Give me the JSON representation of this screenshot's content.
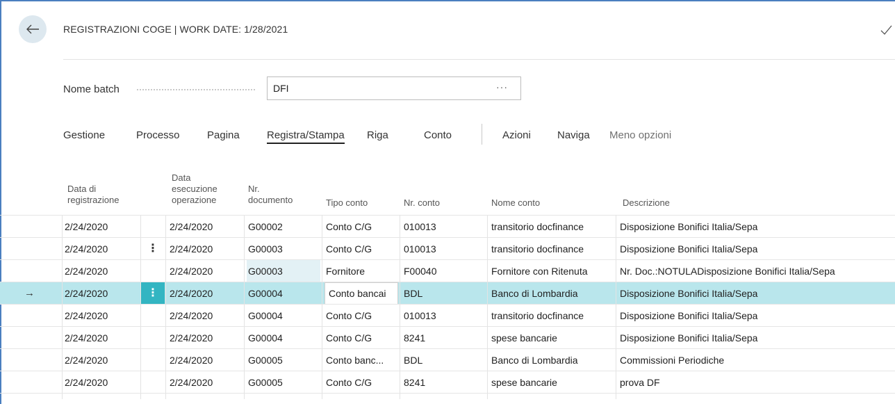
{
  "page": {
    "title": "REGISTRAZIONI COGE | WORK DATE: 1/28/2021"
  },
  "batch": {
    "label": "Nome batch",
    "value": "DFI",
    "lookup": "···"
  },
  "actions": [
    {
      "label": "Gestione"
    },
    {
      "label": "Processo"
    },
    {
      "label": "Pagina"
    },
    {
      "label": "Registra/Stampa"
    },
    {
      "label": "Riga"
    },
    {
      "label": "Conto"
    },
    {
      "label": "Azioni"
    },
    {
      "label": "Naviga"
    },
    {
      "label": "Meno opzioni"
    }
  ],
  "columns": {
    "data_reg": [
      "Data di",
      "registrazione"
    ],
    "data_exec": [
      "Data",
      "esecuzione",
      "operazione"
    ],
    "nr_doc": [
      "Nr.",
      "documento"
    ],
    "tipo_conto": "Tipo conto",
    "nr_conto": "Nr. conto",
    "nome_conto": "Nome conto",
    "descrizione": "Descrizione"
  },
  "rows": [
    {
      "data_reg": "2/24/2020",
      "menu": "",
      "data_exec": "2/24/2020",
      "nr_doc": "G00002",
      "tipo_conto": "Conto C/G",
      "nr_conto": "010013",
      "nome_conto": "transitorio docfinance",
      "descrizione": "Disposizione Bonifici Italia/Sepa"
    },
    {
      "data_reg": "2/24/2020",
      "menu": "⋮",
      "data_exec": "2/24/2020",
      "nr_doc": "G00003",
      "tipo_conto": "Conto C/G",
      "nr_conto": "010013",
      "nome_conto": "transitorio docfinance",
      "descrizione": "Disposizione Bonifici Italia/Sepa"
    },
    {
      "data_reg": "2/24/2020",
      "menu": "",
      "data_exec": "2/24/2020",
      "nr_doc": "G00003",
      "tipo_conto": "Fornitore",
      "nr_conto": "F00040",
      "nome_conto": "Fornitore con Ritenuta",
      "descrizione": "Nr. Doc.:NOTULADisposizione Bonifici Italia/Sepa"
    },
    {
      "marker": "→",
      "data_reg": "2/24/2020",
      "menu": "⋮",
      "data_exec": "2/24/2020",
      "nr_doc": "G00004",
      "tipo_conto": "Conto bancai",
      "nr_conto": "BDL",
      "nome_conto": "Banco di Lombardia",
      "descrizione": "Disposizione Bonifici Italia/Sepa"
    },
    {
      "data_reg": "2/24/2020",
      "menu": "",
      "data_exec": "2/24/2020",
      "nr_doc": "G00004",
      "tipo_conto": "Conto C/G",
      "nr_conto": "010013",
      "nome_conto": "transitorio docfinance",
      "descrizione": "Disposizione Bonifici Italia/Sepa"
    },
    {
      "data_reg": "2/24/2020",
      "menu": "",
      "data_exec": "2/24/2020",
      "nr_doc": "G00004",
      "tipo_conto": "Conto C/G",
      "nr_conto": "8241",
      "nome_conto": "spese bancarie",
      "descrizione": "Disposizione Bonifici Italia/Sepa"
    },
    {
      "data_reg": "2/24/2020",
      "menu": "",
      "data_exec": "2/24/2020",
      "nr_doc": "G00005",
      "tipo_conto": "Conto banc...",
      "nr_conto": "BDL",
      "nome_conto": "Banco di Lombardia",
      "descrizione": "Commissioni Periodiche"
    },
    {
      "data_reg": "2/24/2020",
      "menu": "",
      "data_exec": "2/24/2020",
      "nr_doc": "G00005",
      "tipo_conto": "Conto C/G",
      "nr_conto": "8241",
      "nome_conto": "spese bancarie",
      "descrizione": "prova DF"
    }
  ],
  "colors": {
    "selected_row": "#b9e6ec",
    "row_menu_selected": "#33b5c2",
    "accent_border": "#4a7fbf"
  },
  "icons": {
    "back": "arrow-left-icon",
    "close": "checkmark-icon",
    "row_marker": "arrow-right-icon",
    "row_menu": "vertical-ellipsis-icon"
  }
}
